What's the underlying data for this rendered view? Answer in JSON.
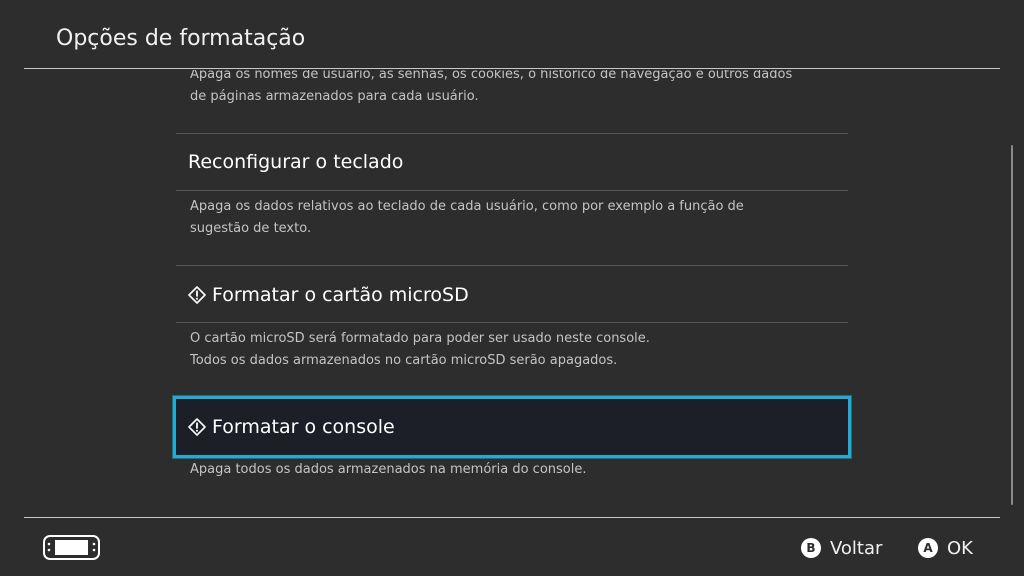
{
  "header": {
    "title": "Opções de formatação"
  },
  "options": [
    {
      "label": "",
      "description_lines": [
        "Apaga os nomes de usuário, as senhas, os cookies, o histórico de navegação e outros dados",
        "de páginas armazenados para cada usuário."
      ]
    },
    {
      "label": "Reconfigurar o teclado",
      "warning": false,
      "description_lines": [
        "Apaga os dados relativos ao teclado de cada usuário, como por exemplo a função de",
        "sugestão de texto."
      ]
    },
    {
      "label": "Formatar o cartão microSD",
      "warning": true,
      "description_lines": [
        "O cartão microSD será formatado para poder ser usado neste console.",
        "Todos os dados armazenados no cartão microSD serão apagados."
      ]
    },
    {
      "label": "Formatar o console",
      "warning": true,
      "selected": true,
      "description_lines": [
        "Apaga todos os dados armazenados na memória do console."
      ]
    }
  ],
  "footer": {
    "controller_icon": "handheld-console-icon",
    "back": {
      "button": "B",
      "label": "Voltar"
    },
    "ok": {
      "button": "A",
      "label": "OK"
    }
  },
  "colors": {
    "background": "#2d2d2d",
    "selection_border": "#2aa9cf",
    "selection_fill": "#1c1f28"
  }
}
